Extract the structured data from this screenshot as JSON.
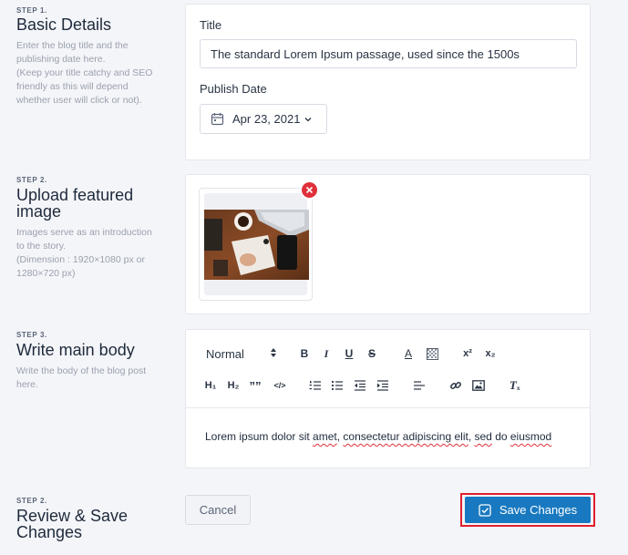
{
  "steps": [
    {
      "label": "STEP 1.",
      "title_lines": [
        "Basic Details"
      ],
      "desc_lines": [
        "Enter the blog title and the",
        "publishing date here.",
        "(Keep your title catchy and SEO",
        "friendly as this will depend",
        "whether user will click or not)."
      ]
    },
    {
      "label": "STEP 2.",
      "title_lines": [
        "Upload featured",
        "image"
      ],
      "desc_lines": [
        "Images serve as an introduction",
        "to the story.",
        "(Dimension : 1920×1080 px or",
        "1280×720 px)"
      ]
    },
    {
      "label": "STEP 3.",
      "title_lines": [
        "Write main body"
      ],
      "desc_lines": [
        "Write the body of the blog post",
        "here."
      ]
    },
    {
      "label": "STEP 2.",
      "title_lines": [
        "Review & Save",
        "Changes"
      ],
      "desc_lines": []
    }
  ],
  "details": {
    "title_label": "Title",
    "title_value": "The standard Lorem Ipsum passage, used since the 1500s",
    "date_label": "Publish Date",
    "date_value": "Apr 23, 2021"
  },
  "editor": {
    "format": "Normal",
    "toolbar": {
      "bold": "B",
      "italic": "I",
      "underline": "U",
      "strike": "S",
      "color": "A",
      "h1": "H₁",
      "h2": "H₂",
      "quote": "””",
      "code": "</>",
      "superscript": "x²",
      "subscript": "x₂",
      "clear_format": "Tₓ"
    },
    "content_plain_1": "Lorem ipsum dolor sit ",
    "content_err_1": "amet",
    "content_plain_2": ", ",
    "content_err_2": "consectetur adipiscing elit",
    "content_plain_3": ", ",
    "content_err_3": "sed",
    "content_plain_4": " do ",
    "content_err_4": "eiusmod"
  },
  "actions": {
    "cancel": "Cancel",
    "save": "Save Changes"
  },
  "colors": {
    "primary": "#1979c0",
    "danger": "#e0303b",
    "highlight": "#e0202e"
  },
  "icons": [
    "calendar-icon",
    "chevron-down-icon",
    "close-icon",
    "check-square-icon",
    "ordered-list-icon",
    "bullet-list-icon",
    "outdent-icon",
    "indent-icon",
    "align-icon",
    "link-icon",
    "image-icon",
    "background-icon"
  ]
}
